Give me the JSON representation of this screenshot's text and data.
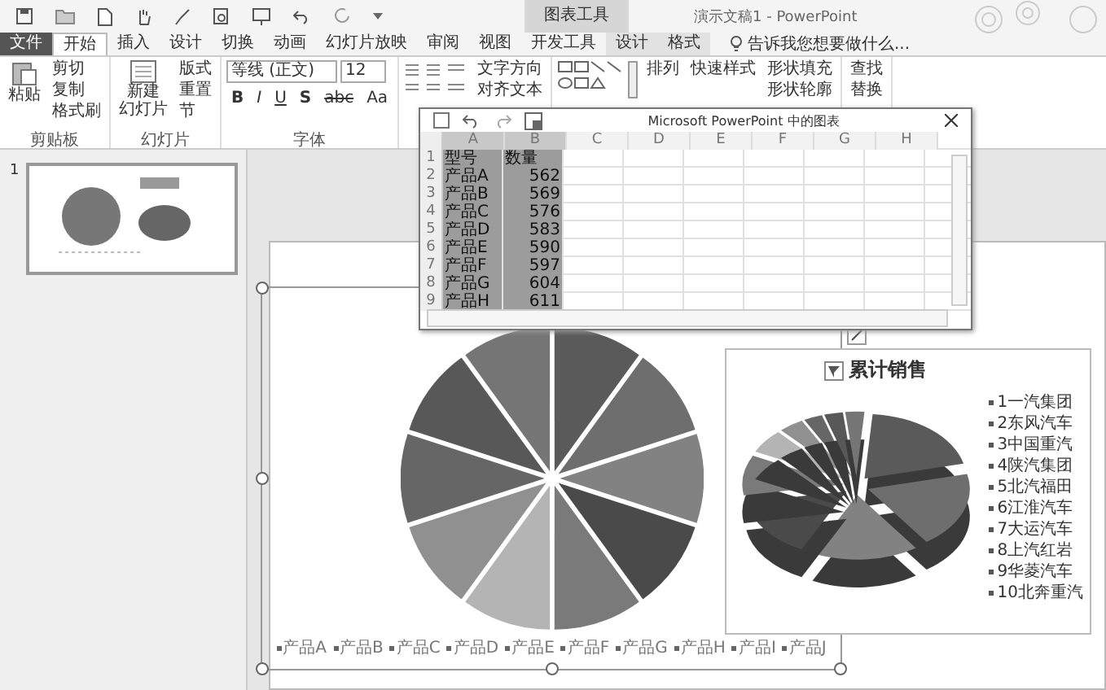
{
  "title_bar": {
    "context_tab": "图表工具",
    "title": "演示文稿1 - PowerPoint"
  },
  "ribbon_tabs": [
    {
      "label": "文件",
      "selected": false,
      "kind": "file"
    },
    {
      "label": "开始",
      "selected": true,
      "kind": "tab"
    },
    {
      "label": "插入",
      "selected": false,
      "kind": "tab"
    },
    {
      "label": "设计",
      "selected": false,
      "kind": "tab"
    },
    {
      "label": "切换",
      "selected": false,
      "kind": "tab"
    },
    {
      "label": "动画",
      "selected": false,
      "kind": "tab"
    },
    {
      "label": "幻灯片放映",
      "selected": false,
      "kind": "tab"
    },
    {
      "label": "审阅",
      "selected": false,
      "kind": "tab"
    },
    {
      "label": "视图",
      "selected": false,
      "kind": "tab"
    },
    {
      "label": "开发工具",
      "selected": false,
      "kind": "tab"
    },
    {
      "label": "设计",
      "selected": false,
      "kind": "context"
    },
    {
      "label": "格式",
      "selected": false,
      "kind": "context"
    }
  ],
  "tell_me": "告诉我您想要做什么...",
  "ribbon": {
    "clipboard": {
      "label": "剪贴板",
      "paste": "粘贴",
      "items": [
        "剪切",
        "复制",
        "格式刷"
      ]
    },
    "slides": {
      "label": "幻灯片",
      "new_slide": [
        "新建",
        "幻灯片"
      ],
      "items": [
        "版式",
        "重置",
        "节"
      ]
    },
    "font": {
      "label": "字体",
      "name": "等线 (正文)",
      "size": "12",
      "buttons": [
        "B",
        "I",
        "U",
        "S",
        "abc",
        "Aa"
      ]
    },
    "paragraph": {
      "items": [
        "文字方向",
        "对齐文本"
      ]
    },
    "drawing": {
      "items": [
        "排列",
        "快速样式"
      ],
      "shape_items": [
        "形状填充",
        "形状轮廓"
      ]
    },
    "editing": {
      "items": [
        "查找",
        "替换"
      ]
    }
  },
  "thumbnail": {
    "number": "1"
  },
  "sheet": {
    "title": "Microsoft PowerPoint 中的图表",
    "columns": [
      {
        "label": "A",
        "selected": true
      },
      {
        "label": "B",
        "selected": true
      },
      {
        "label": "C",
        "selected": false
      },
      {
        "label": "D",
        "selected": false
      },
      {
        "label": "E",
        "selected": false
      },
      {
        "label": "F",
        "selected": false
      },
      {
        "label": "G",
        "selected": false
      },
      {
        "label": "H",
        "selected": false
      }
    ],
    "rows": [
      {
        "num": "1",
        "cells": [
          "型号",
          "数量"
        ]
      },
      {
        "num": "2",
        "cells": [
          "产品A",
          "562"
        ]
      },
      {
        "num": "3",
        "cells": [
          "产品B",
          "569"
        ]
      },
      {
        "num": "4",
        "cells": [
          "产品C",
          "576"
        ]
      },
      {
        "num": "5",
        "cells": [
          "产品D",
          "583"
        ]
      },
      {
        "num": "6",
        "cells": [
          "产品E",
          "590"
        ]
      },
      {
        "num": "7",
        "cells": [
          "产品F",
          "597"
        ]
      },
      {
        "num": "8",
        "cells": [
          "产品G",
          "604"
        ]
      },
      {
        "num": "9",
        "cells": [
          "产品H",
          "611"
        ]
      }
    ]
  },
  "pie_chart": {
    "legend": [
      "产品A",
      "产品B",
      "产品C",
      "产品D",
      "产品E",
      "产品F",
      "产品G",
      "产品H",
      "产品I",
      "产品J"
    ]
  },
  "pie_3d_chart": {
    "title": "累计销售",
    "legend": [
      "1一汽集团",
      "2东风汽车",
      "3中国重汽",
      "4陕汽集团",
      "5北汽福田",
      "6江淮汽车",
      "7大运汽车",
      "8上汽红岩",
      "9华菱汽车",
      "10北奔重汽"
    ]
  }
}
